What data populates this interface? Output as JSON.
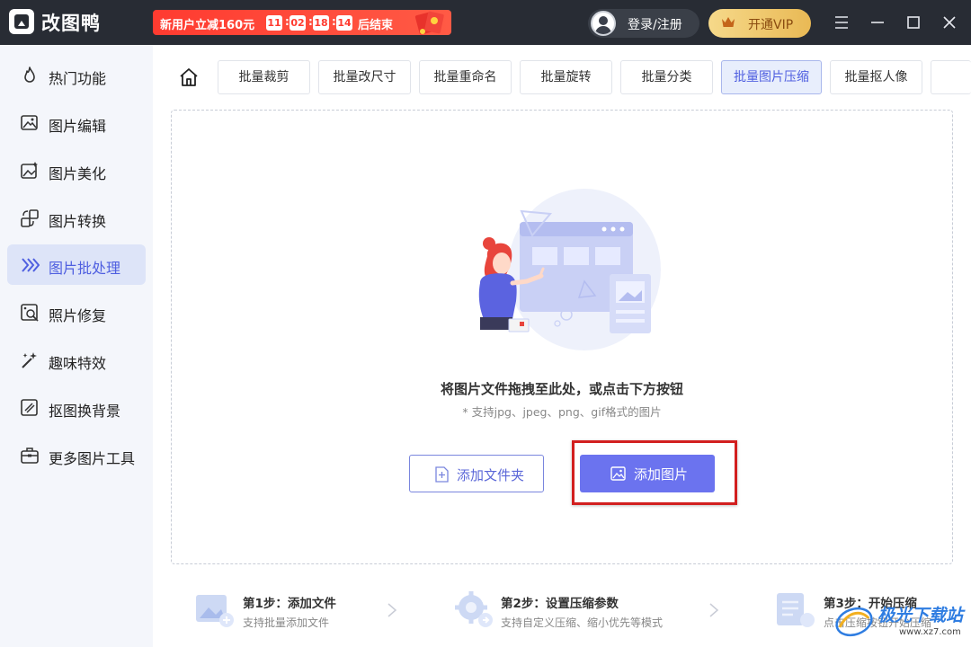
{
  "app": {
    "title": "改图鸭",
    "brand_color": "#282c34",
    "accent_color": "#6b73ef"
  },
  "promo": {
    "text": "新用户立减160元",
    "countdown": [
      "11",
      "02",
      "18",
      "14"
    ],
    "end_text": "后结束",
    "icon": "red-envelope-icon"
  },
  "header": {
    "login_label": "登录/注册",
    "vip_label": "开通VIP",
    "menu_icon": "hamburger-menu-icon",
    "minimize_icon": "minimize-icon",
    "maximize_icon": "maximize-icon",
    "close_icon": "close-icon"
  },
  "sidebar": {
    "items": [
      {
        "label": "热门功能",
        "icon": "flame-icon"
      },
      {
        "label": "图片编辑",
        "icon": "image-edit-icon"
      },
      {
        "label": "图片美化",
        "icon": "image-beautify-icon"
      },
      {
        "label": "图片转换",
        "icon": "image-convert-icon"
      },
      {
        "label": "图片批处理",
        "icon": "batch-process-icon",
        "active": true
      },
      {
        "label": "照片修复",
        "icon": "photo-repair-icon"
      },
      {
        "label": "趣味特效",
        "icon": "magic-wand-icon"
      },
      {
        "label": "抠图换背景",
        "icon": "cutout-icon"
      },
      {
        "label": "更多图片工具",
        "icon": "toolbox-icon"
      }
    ]
  },
  "tabs": [
    {
      "label": "批量裁剪"
    },
    {
      "label": "批量改尺寸"
    },
    {
      "label": "批量重命名"
    },
    {
      "label": "批量旋转"
    },
    {
      "label": "批量分类"
    },
    {
      "label": "批量图片压缩",
      "active": true
    },
    {
      "label": "批量抠人像"
    }
  ],
  "drop": {
    "title": "将图片文件拖拽至此处，或点击下方按钮",
    "subtitle": "* 支持jpg、jpeg、png、gif格式的图片",
    "add_folder_label": "添加文件夹",
    "add_image_label": "添加图片"
  },
  "steps": [
    {
      "title": "第1步：添加文件",
      "desc": "支持批量添加文件",
      "icon": "add-image-step-icon"
    },
    {
      "title": "第2步：设置压缩参数",
      "desc": "支持自定义压缩、缩小优先等模式",
      "icon": "settings-gear-icon"
    },
    {
      "title": "第3步：开始压缩",
      "desc": "点击压缩按钮开始压缩",
      "icon": "document-step-icon"
    }
  ],
  "watermark": {
    "text": "极光下载站",
    "url": "www.xz7.com"
  }
}
